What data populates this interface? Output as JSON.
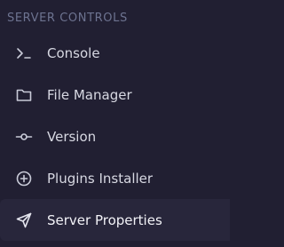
{
  "section": {
    "title": "SERVER CONTROLS"
  },
  "nav": {
    "items": [
      {
        "label": "Console",
        "icon": "terminal-icon"
      },
      {
        "label": "File Manager",
        "icon": "folder-icon"
      },
      {
        "label": "Version",
        "icon": "commit-icon"
      },
      {
        "label": "Plugins Installer",
        "icon": "plus-circle-icon"
      },
      {
        "label": "Server Properties",
        "icon": "send-icon",
        "active": true
      }
    ]
  },
  "colors": {
    "background": "#211f32",
    "active_background": "#28263b",
    "section_title": "#6d7390",
    "label": "#d7d8e2",
    "icon": "#c9cbd8"
  }
}
